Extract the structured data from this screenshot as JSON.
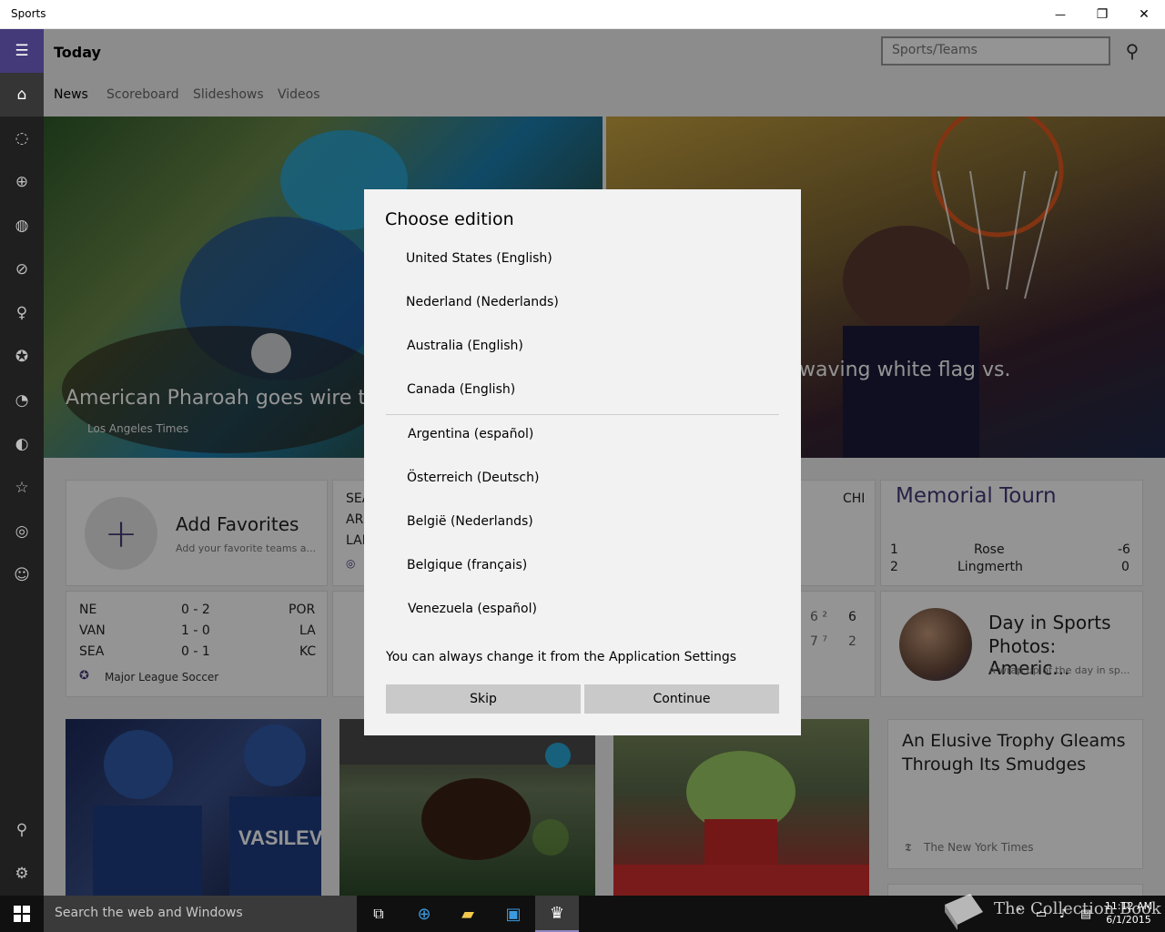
{
  "window": {
    "title": "Sports",
    "minimize": "—",
    "maximize": "❐",
    "close": "✕"
  },
  "sidebar": {
    "items": [
      {
        "icon": "hamburger-icon",
        "glyph": "☰"
      },
      {
        "icon": "home-icon",
        "glyph": "⌂"
      },
      {
        "icon": "football-icon",
        "glyph": "◌"
      },
      {
        "icon": "basketball-icon",
        "glyph": "⊕"
      },
      {
        "icon": "baseball-icon",
        "glyph": "◍"
      },
      {
        "icon": "hockey-icon",
        "glyph": "⊘"
      },
      {
        "icon": "golf-icon",
        "glyph": "♀"
      },
      {
        "icon": "soccer-icon",
        "glyph": "✪"
      },
      {
        "icon": "tennis-icon",
        "glyph": "◔"
      },
      {
        "icon": "racing-icon",
        "glyph": "◐"
      },
      {
        "icon": "favorites-star-icon",
        "glyph": "☆"
      },
      {
        "icon": "sports-globe-icon",
        "glyph": "◎"
      },
      {
        "icon": "fun-smiley-icon",
        "glyph": "☺"
      },
      {
        "icon": "account-icon",
        "glyph": "⚲"
      },
      {
        "icon": "settings-gear-icon",
        "glyph": "⚙"
      }
    ]
  },
  "header": {
    "title": "Today",
    "search_placeholder": "Sports/Teams",
    "search_glyph": "⚲",
    "tabs": [
      "News",
      "Scoreboard",
      "Slideshows",
      "Videos"
    ]
  },
  "hero": {
    "left_caption": "American Pharoah goes wire to",
    "left_source": "Los Angeles Times",
    "right_caption": "waving white flag vs."
  },
  "favorites": {
    "plus": "+",
    "title": "Add Favorites",
    "subtitle": "Add your favorite teams a..."
  },
  "partial_scores": {
    "top": [
      "SEA",
      "AR",
      "LAI"
    ],
    "team_right": "CHI"
  },
  "tournament": {
    "title": "Memorial Tourn",
    "rows": [
      {
        "pos": "1",
        "name": "Rose",
        "score": "-6"
      },
      {
        "pos": "2",
        "name": "Lingmerth",
        "score": "0"
      }
    ]
  },
  "mls": {
    "rows": [
      {
        "home": "NE",
        "score": "0  -  2",
        "away": "POR"
      },
      {
        "home": "VAN",
        "score": "1  -  0",
        "away": "LA"
      },
      {
        "home": "SEA",
        "score": "0  -  1",
        "away": "KC"
      }
    ],
    "league": "Major League Soccer"
  },
  "partial_right_scores": [
    {
      "a": "6 ²",
      "b": "6"
    },
    {
      "a": "7 ⁷",
      "b": "2"
    }
  ],
  "day_in_sports": {
    "title_1": "Day in Sports",
    "title_2": "Photos: Americ...",
    "subtitle": "A wrap up of the day in sp..."
  },
  "article": {
    "title_1": "An Elusive Trophy Gleams",
    "title_2": "Through Its Smudges",
    "source": "The New York Times"
  },
  "photo_text": {
    "jersey": "VASILEVS"
  },
  "dialog": {
    "title": "Choose edition",
    "editions_top": [
      "United States (English)",
      "Nederland (Nederlands)",
      "Australia (English)",
      "Canada (English)"
    ],
    "editions_bottom": [
      "Argentina (español)",
      "Österreich (Deutsch)",
      "België (Nederlands)",
      "Belgique (français)",
      "Venezuela (español)"
    ],
    "note": "You can always change it from the Application Settings",
    "skip": "Skip",
    "continue": "Continue"
  },
  "taskbar": {
    "search_placeholder": "Search the web and Windows",
    "time": "11:12 AM",
    "date": "6/1/2015",
    "watermark": "The Collection Book"
  }
}
